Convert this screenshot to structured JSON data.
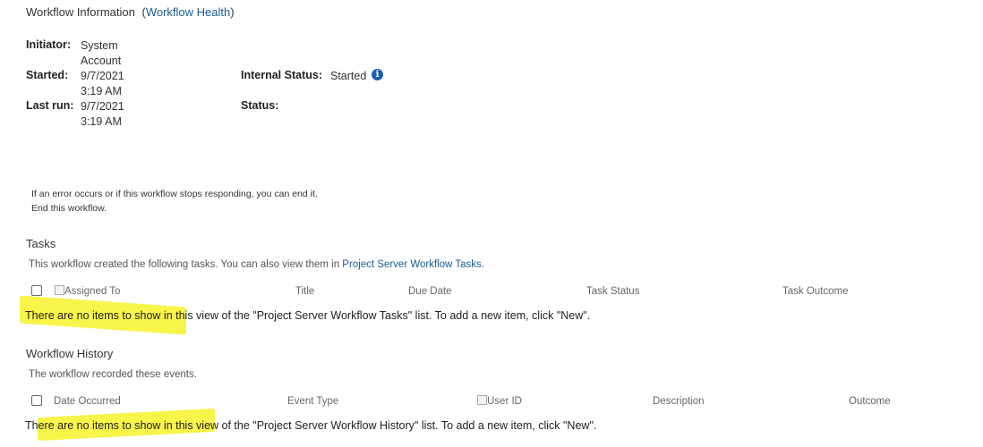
{
  "header": {
    "title": "Workflow Information",
    "open_paren": "(",
    "health_link": "Workflow Health",
    "close_paren": ")"
  },
  "info": {
    "initiator_label": "Initiator:",
    "initiator_line1": "System",
    "initiator_line2": "Account",
    "started_label": "Started:",
    "started_line1": "9/7/2021",
    "started_line2": "3:19 AM",
    "lastrun_label": "Last run:",
    "lastrun_line1": "9/7/2021",
    "lastrun_line2": "3:19 AM",
    "internal_status_label": "Internal Status:",
    "internal_status_value": "Started",
    "info_icon": "info-icon",
    "status_label": "Status:"
  },
  "end_workflow": {
    "message": "If an error occurs or if this workflow stops responding, you can end it.",
    "link": "End this workflow."
  },
  "tasks": {
    "heading": "Tasks",
    "description_prefix": "This workflow created the following tasks. You can also view them in",
    "description_link": "Project Server Workflow Tasks",
    "description_suffix": ".",
    "columns": [
      "Assigned To",
      "Title",
      "Due Date",
      "Task Status",
      "Task Outcome"
    ],
    "empty_message": "There are no items to show in this view of the \"Project Server Workflow Tasks\" list. To add a new item, click \"New\"."
  },
  "history": {
    "heading": "Workflow History",
    "description": "The workflow recorded these events.",
    "columns": [
      "Date Occurred",
      "Event Type",
      "User ID",
      "Description",
      "Outcome"
    ],
    "empty_message": "There are no items to show in this view of the \"Project Server Workflow History\" list. To add a new item, click \"New\"."
  },
  "colors": {
    "link": "#1b5a96",
    "highlight": "#f6f22a",
    "info_icon": "#1e5fb3"
  }
}
